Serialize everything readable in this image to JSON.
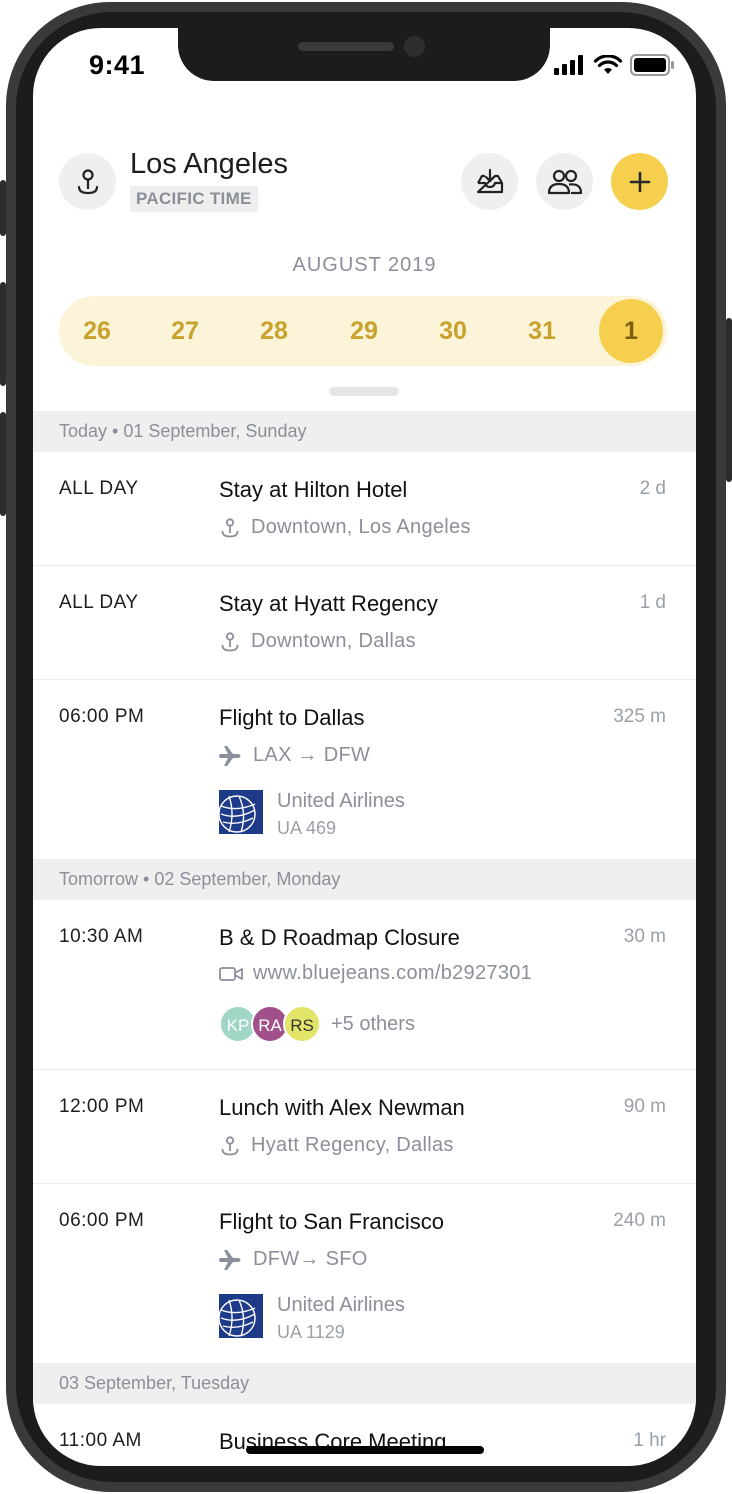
{
  "status": {
    "time": "9:41"
  },
  "header": {
    "city": "Los Angeles",
    "timezone": "PACIFIC TIME"
  },
  "calendar": {
    "month": "AUGUST 2019",
    "dates": [
      "26",
      "27",
      "28",
      "29",
      "30",
      "31",
      "1"
    ],
    "selected": "1"
  },
  "sections": [
    {
      "header": "Today • 01 September, Sunday",
      "events": [
        {
          "time": "ALL DAY",
          "title": "Stay at Hilton Hotel",
          "duration": "2 d",
          "location": "Downtown, Los Angeles"
        },
        {
          "time": "ALL DAY",
          "title": "Stay at Hyatt Regency",
          "duration": "1 d",
          "location": "Downtown, Dallas"
        },
        {
          "time": "06:00 PM",
          "title": "Flight to Dallas",
          "duration": "325 m",
          "route": "LAX → DFW",
          "airline": "United Airlines",
          "flight": "UA 469"
        }
      ]
    },
    {
      "header": "Tomorrow • 02 September, Monday",
      "events": [
        {
          "time": "10:30 AM",
          "title": "B & D Roadmap Closure",
          "duration": "30 m",
          "link": "www.bluejeans.com/b2927301",
          "attendees": [
            "KP",
            "RA",
            "RS"
          ],
          "others": "+5 others"
        },
        {
          "time": "12:00 PM",
          "title": "Lunch with Alex Newman",
          "duration": "90 m",
          "location": "Hyatt Regency, Dallas"
        },
        {
          "time": "06:00 PM",
          "title": "Flight to San Francisco",
          "duration": "240 m",
          "route": "DFW→ SFO",
          "airline": "United Airlines",
          "flight": "UA 1129"
        }
      ]
    },
    {
      "header": "03 September, Tuesday",
      "events": [
        {
          "time": "11:00 AM",
          "title": "Business Core Meeting",
          "duration": "1 hr"
        }
      ]
    }
  ],
  "colors": {
    "accent": "#f6cf4f",
    "accent_soft": "#fbf4d9",
    "avatar_kp": "#9fd6c6",
    "avatar_ra": "#a0508a",
    "avatar_rs": "#e3e56a"
  }
}
